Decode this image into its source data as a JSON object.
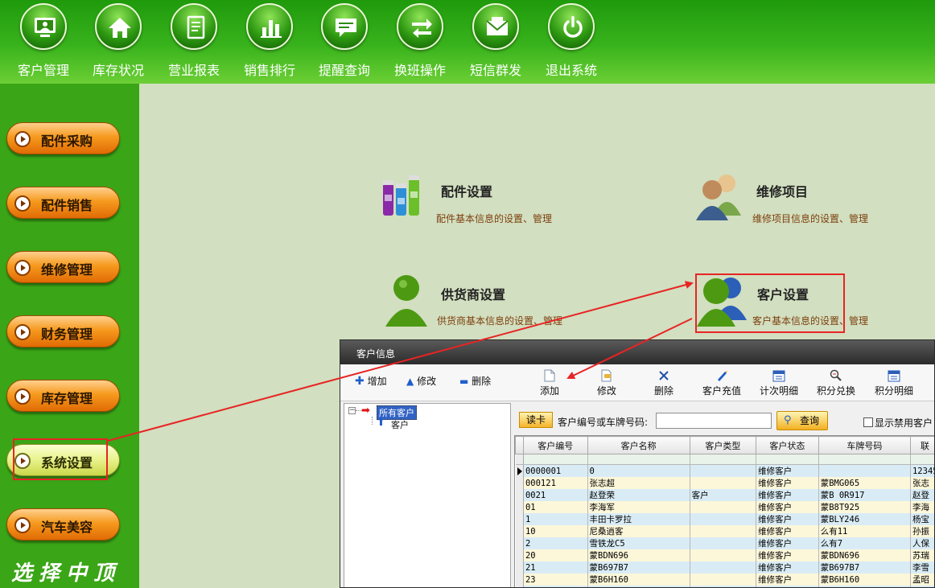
{
  "topnav": [
    {
      "label": "客户管理",
      "icon": "monitor-user-icon"
    },
    {
      "label": "库存状况",
      "icon": "home-icon"
    },
    {
      "label": "营业报表",
      "icon": "report-icon"
    },
    {
      "label": "销售排行",
      "icon": "bar-chart-icon"
    },
    {
      "label": "提醒查询",
      "icon": "message-icon"
    },
    {
      "label": "换班操作",
      "icon": "swap-icon"
    },
    {
      "label": "短信群发",
      "icon": "mail-icon"
    },
    {
      "label": "退出系统",
      "icon": "power-icon"
    }
  ],
  "sidebar": {
    "items": [
      {
        "label": "配件采购"
      },
      {
        "label": "配件销售"
      },
      {
        "label": "维修管理"
      },
      {
        "label": "财务管理"
      },
      {
        "label": "库存管理"
      },
      {
        "label": "系统设置",
        "active": true
      },
      {
        "label": "汽车美容"
      }
    ],
    "slogan": "选择中顶"
  },
  "settings": {
    "parts": {
      "title": "配件设置",
      "desc": "配件基本信息的设置、管理"
    },
    "repair": {
      "title": "维修项目",
      "desc": "维修项目信息的设置、管理"
    },
    "supplier": {
      "title": "供货商设置",
      "desc": "供货商基本信息的设置、管理"
    },
    "customer": {
      "title": "客户设置",
      "desc": "客户基本信息的设置、管理"
    }
  },
  "customer_window": {
    "title": "客户信息",
    "left_toolbar": {
      "add": "增加",
      "edit": "修改",
      "delete": "删除"
    },
    "toolbar": [
      "添加",
      "修改",
      "删除",
      "客户充值",
      "计次明细",
      "积分兑换",
      "积分明细"
    ],
    "tree": {
      "root": "所有客户",
      "child": "客户"
    },
    "search": {
      "read_card": "读卡",
      "label": "客户编号或车牌号码:",
      "value": "",
      "query": "查询",
      "show_disabled": "显示禁用客户"
    },
    "table": {
      "columns": [
        "客户编号",
        "客户名称",
        "客户类型",
        "客户状态",
        "车牌号码",
        "联"
      ],
      "rows": [
        [
          "0000001",
          "0",
          "",
          "维修客户",
          "",
          "12345"
        ],
        [
          "000121",
          "张志超",
          "",
          "维修客户",
          "蒙BMG065",
          "张志"
        ],
        [
          "0021",
          "赵登荣",
          "客户",
          "维修客户",
          "蒙B 0R917",
          "赵登"
        ],
        [
          "01",
          "李海军",
          "",
          "维修客户",
          "蒙B8T925",
          "李海"
        ],
        [
          "1",
          "丰田卡罗拉",
          "",
          "维修客户",
          "蒙BLY246",
          "杨宝"
        ],
        [
          "10",
          "尼桑逍客",
          "",
          "维修客户",
          "么有11",
          "孙振"
        ],
        [
          "2",
          "雪铁龙C5",
          "",
          "维修客户",
          "么有7",
          "人保"
        ],
        [
          "20",
          "蒙BDN696",
          "",
          "维修客户",
          "蒙BDN696",
          "苏瑞"
        ],
        [
          "21",
          "蒙B697B7",
          "",
          "维修客户",
          "蒙B697B7",
          "李雪"
        ],
        [
          "23",
          "蒙B6H160",
          "",
          "维修客户",
          "蒙B6H160",
          "孟昭"
        ],
        [
          "",
          "",
          "",
          "",
          "",
          ""
        ]
      ]
    }
  },
  "colors": {
    "topbar": "#2fa515",
    "sidebar": "#3aa516",
    "main_bg": "#d2dfc0",
    "orange_button": "#f69a1e",
    "active_button": "#e8f28b",
    "highlight_red": "#e82424",
    "desc_text": "#7d3f0e"
  }
}
